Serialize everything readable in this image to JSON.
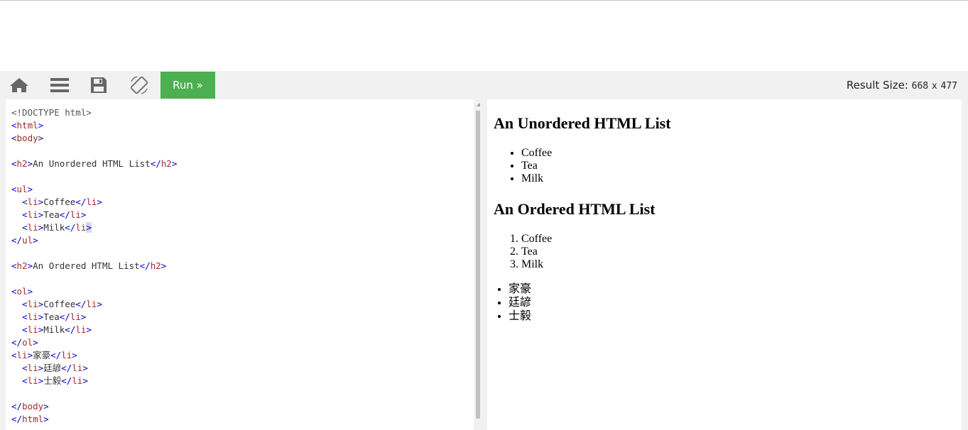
{
  "toolbar": {
    "run_label": "Run »",
    "result_size_label": "Result Size:",
    "result_width": "668",
    "result_times": "x",
    "result_height": "477",
    "icons": [
      "home-icon",
      "menu-icon",
      "save-icon",
      "rotate-icon"
    ]
  },
  "editor": {
    "lines": [
      "<!DOCTYPE html>",
      "<html>",
      "<body>",
      "",
      "<h2>An Unordered HTML List</h2>",
      "",
      "<ul>",
      "  <li>Coffee</li>",
      "  <li>Tea</li>",
      "  <li>Milk</li>",
      "</ul>",
      "",
      "<h2>An Ordered HTML List</h2>",
      "",
      "<ol>",
      "  <li>Coffee</li>",
      "  <li>Tea</li>",
      "  <li>Milk</li>",
      "</ol>",
      "<li>家豪</li>",
      "  <li>廷諺</li>",
      "  <li>士毅</li>",
      "",
      "</body>",
      "</html>"
    ]
  },
  "result": {
    "heading_unordered": "An Unordered HTML List",
    "unordered_items": [
      "Coffee",
      "Tea",
      "Milk"
    ],
    "heading_ordered": "An Ordered HTML List",
    "ordered_items": [
      "Coffee",
      "Tea",
      "Milk"
    ],
    "extra_items": [
      "家豪",
      "廷諺",
      "士毅"
    ]
  }
}
